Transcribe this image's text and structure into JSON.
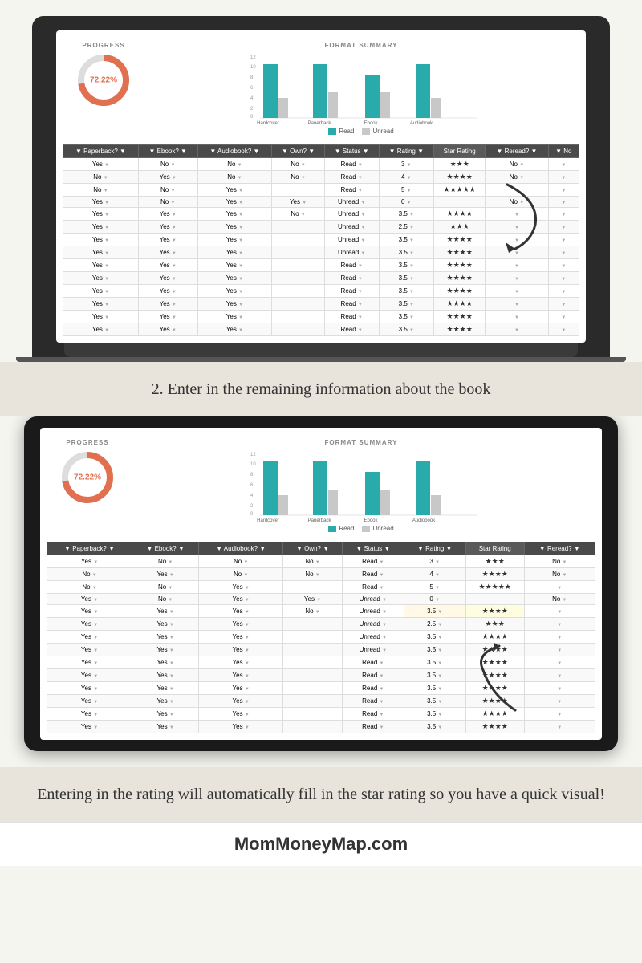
{
  "progress": {
    "label": "PROGRESS",
    "value": "72.22%",
    "percent": 72.22
  },
  "chart": {
    "title": "FORMAT SUMMARY",
    "categories": [
      "Hardcover",
      "Paperback",
      "Ebook",
      "Audiobook"
    ],
    "read_values": [
      10,
      10,
      8,
      10
    ],
    "unread_values": [
      3,
      4,
      4,
      3
    ],
    "legend_read": "Read",
    "legend_unread": "Unread",
    "read_color": "#2aabab",
    "unread_color": "#c8c8c8"
  },
  "table": {
    "headers": [
      "Paperback?",
      "Ebook?",
      "Audiobook?",
      "Own?",
      "Status",
      "Rating",
      "Star Rating",
      "Reread?",
      "No"
    ],
    "rows": [
      [
        "Yes",
        "No",
        "No",
        "No",
        "Read",
        "3",
        "★★★",
        "No",
        ""
      ],
      [
        "No",
        "Yes",
        "No",
        "No",
        "Read",
        "4",
        "★★★★",
        "No",
        ""
      ],
      [
        "No",
        "No",
        "Yes",
        "",
        "Read",
        "5",
        "★★★★★",
        "",
        ""
      ],
      [
        "Yes",
        "No",
        "Yes",
        "Yes",
        "Unread",
        "0",
        "",
        "No",
        ""
      ],
      [
        "Yes",
        "Yes",
        "Yes",
        "No",
        "Unread",
        "3.5",
        "★★★★",
        "",
        ""
      ],
      [
        "Yes",
        "Yes",
        "Yes",
        "",
        "Unread",
        "2.5",
        "★★★",
        "",
        ""
      ],
      [
        "Yes",
        "Yes",
        "Yes",
        "",
        "Unread",
        "3.5",
        "★★★★",
        "",
        ""
      ],
      [
        "Yes",
        "Yes",
        "Yes",
        "",
        "Unread",
        "3.5",
        "★★★★",
        "",
        ""
      ],
      [
        "Yes",
        "Yes",
        "Yes",
        "",
        "Read",
        "3.5",
        "★★★★",
        "",
        ""
      ],
      [
        "Yes",
        "Yes",
        "Yes",
        "",
        "Read",
        "3.5",
        "★★★★",
        "",
        ""
      ],
      [
        "Yes",
        "Yes",
        "Yes",
        "",
        "Read",
        "3.5",
        "★★★★",
        "",
        ""
      ],
      [
        "Yes",
        "Yes",
        "Yes",
        "",
        "Read",
        "3.5",
        "★★★★",
        "",
        ""
      ],
      [
        "Yes",
        "Yes",
        "Yes",
        "",
        "Read",
        "3.5",
        "★★★★",
        "",
        ""
      ],
      [
        "Yes",
        "Yes",
        "Yes",
        "",
        "Read",
        "3.5",
        "★★★★",
        "",
        ""
      ]
    ]
  },
  "instruction1": {
    "text": "2. Enter in the remaining information about the book"
  },
  "instruction2": {
    "text": "Entering in the rating will automatically fill in the star rating so you have a quick visual!"
  },
  "footer": {
    "text": "MomMoneyMap.com"
  }
}
